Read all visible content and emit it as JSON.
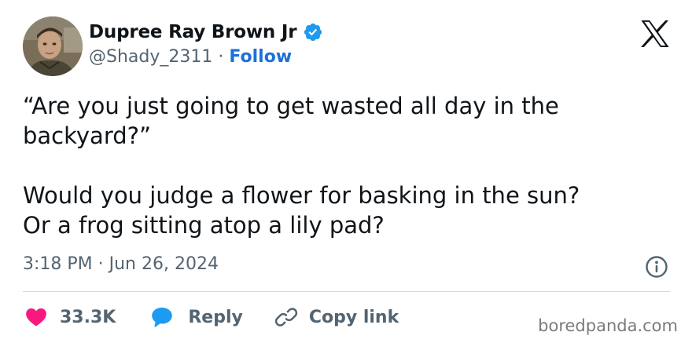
{
  "author": {
    "name": "Dupree Ray Brown Jr",
    "handle": "@Shady_2311",
    "separator": "·",
    "follow_label": "Follow"
  },
  "icons": {
    "verified": "verified-badge-icon",
    "platform_logo": "x-logo-icon",
    "info": "info-icon",
    "like": "heart-icon",
    "reply": "reply-bubble-icon",
    "copy": "link-icon"
  },
  "tweet": {
    "line1": "“Are you just going to get wasted all day in the",
    "line2": "backyard?”",
    "line3": "Would you judge a flower for basking in the sun?",
    "line4": "Or a frog sitting atop a lily pad?"
  },
  "timestamp": "3:18 PM · Jun 26, 2024",
  "actions": {
    "like_count": "33.3K",
    "reply_label": "Reply",
    "copy_label": "Copy link"
  },
  "watermark": "boredpanda.com",
  "colors": {
    "follow_blue": "#1d70d8",
    "verified_blue": "#1d9bf0",
    "like_pink": "#f91880",
    "reply_blue": "#1d9bf0",
    "muted_gray": "#536471",
    "text": "#0f1419",
    "divider": "#cfd9de"
  }
}
